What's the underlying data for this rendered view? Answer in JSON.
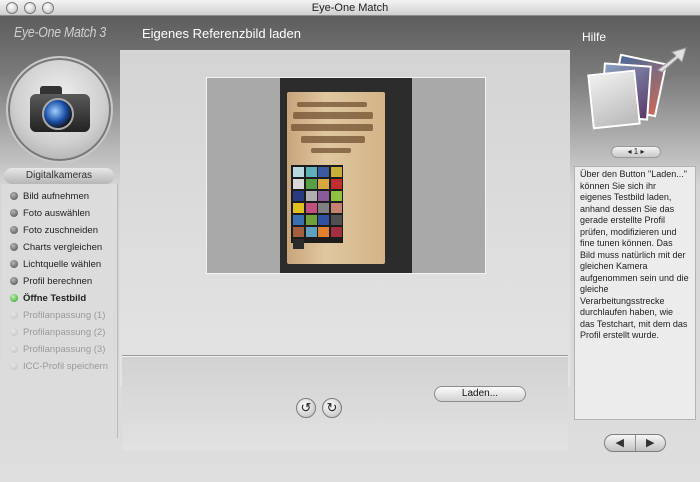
{
  "window": {
    "title": "Eye-One Match"
  },
  "brand": "Eye-One Match 3",
  "page_title": "Eigenes Referenzbild laden",
  "help_title": "Hilfe",
  "section_label": "Digitalkameras",
  "steps": [
    {
      "label": "Bild aufnehmen",
      "state": "done"
    },
    {
      "label": "Foto auswählen",
      "state": "done"
    },
    {
      "label": "Foto zuschneiden",
      "state": "done"
    },
    {
      "label": "Charts vergleichen",
      "state": "done"
    },
    {
      "label": "Lichtquelle wählen",
      "state": "done"
    },
    {
      "label": "Profil berechnen",
      "state": "done"
    },
    {
      "label": "Öffne Testbild",
      "state": "active"
    },
    {
      "label": "Profilanpassung (1)",
      "state": "disabled"
    },
    {
      "label": "Profilanpassung (2)",
      "state": "disabled"
    },
    {
      "label": "Profilanpassung (3)",
      "state": "disabled"
    },
    {
      "label": "ICC-Profil speichern",
      "state": "disabled"
    }
  ],
  "buttons": {
    "load": "Laden...",
    "rotate_left_icon": "rotate-left-icon",
    "rotate_right_icon": "rotate-right-icon"
  },
  "help_pager": {
    "page": "1"
  },
  "help_text": "Über den Button \"Laden...\" können Sie sich ihr eigenes Testbild laden, anhand dessen Sie das gerade erstellte Profil prüfen, modifizieren und fine tunen können. Das Bild muss natürlich mit der gleichen Kamera aufgenommen sein und die gleiche Verarbeitungsstrecke durchlaufen haben, wie das Testchart, mit dem das Profil erstellt wurde.",
  "nav": {
    "back": "◀",
    "forward": "▶"
  },
  "colors": {
    "active_step": "#2d9a24",
    "chart_patches": [
      "#b8d8e0",
      "#5fb0b8",
      "#3c5aa0",
      "#c8b038",
      "#d8d8d8",
      "#58a048",
      "#d8a840",
      "#c03030",
      "#2a3a80",
      "#b0b0b0",
      "#8a5a9a",
      "#90c040",
      "#e0c020",
      "#c05080",
      "#808080",
      "#c88070",
      "#3a70b0",
      "#70a038",
      "#3050a0",
      "#505050",
      "#a06040",
      "#60a0c0",
      "#e08030",
      "#a03040",
      "#2a2a2a"
    ]
  }
}
